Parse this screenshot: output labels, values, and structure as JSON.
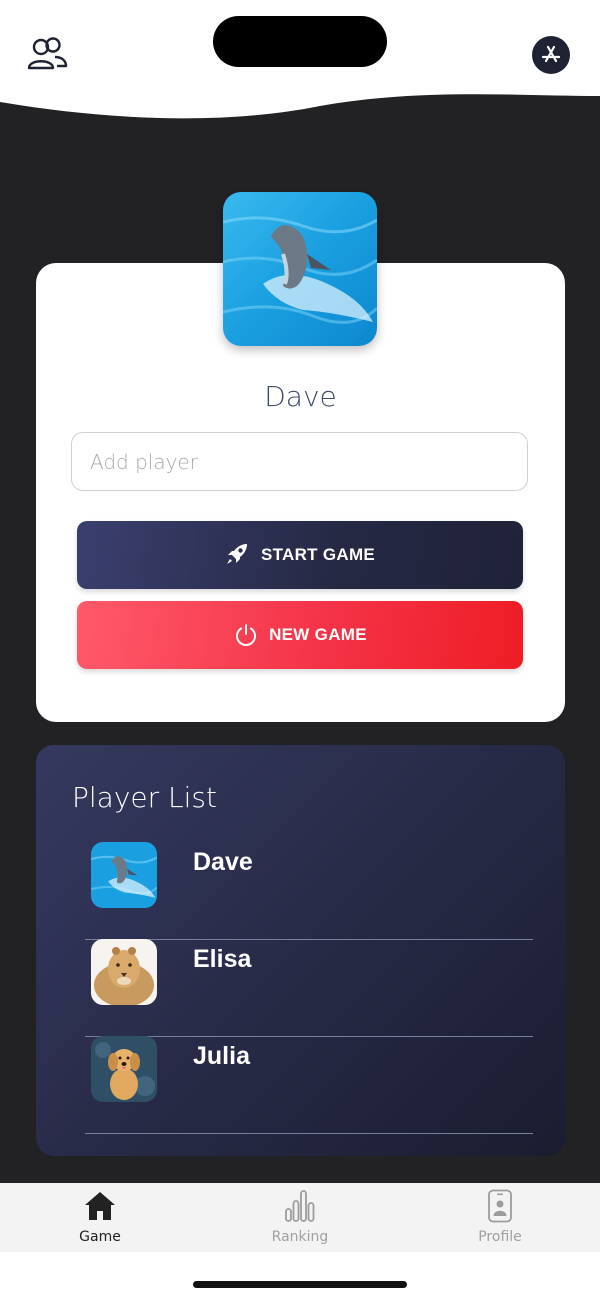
{
  "player": {
    "name": "Dave"
  },
  "add_player": {
    "placeholder": "Add player"
  },
  "buttons": {
    "start": "START GAME",
    "new": "NEW GAME"
  },
  "player_list": {
    "title": "Player List",
    "items": [
      {
        "name": "Dave",
        "avatar": "dolphin"
      },
      {
        "name": "Elisa",
        "avatar": "lion"
      },
      {
        "name": "Julia",
        "avatar": "golden-retriever"
      }
    ]
  },
  "tabs": [
    {
      "label": "Game",
      "icon": "home-icon",
      "active": true
    },
    {
      "label": "Ranking",
      "icon": "bar-chart-icon",
      "active": false
    },
    {
      "label": "Profile",
      "icon": "phone-profile-icon",
      "active": false
    }
  ],
  "header": {
    "left_icon": "players-icon",
    "right_icon": "app-store-icon"
  },
  "colors": {
    "background": "#222224",
    "accent_dark": "#2b2e4d",
    "accent_red": "#f43348",
    "name_text": "#3b4a66"
  }
}
